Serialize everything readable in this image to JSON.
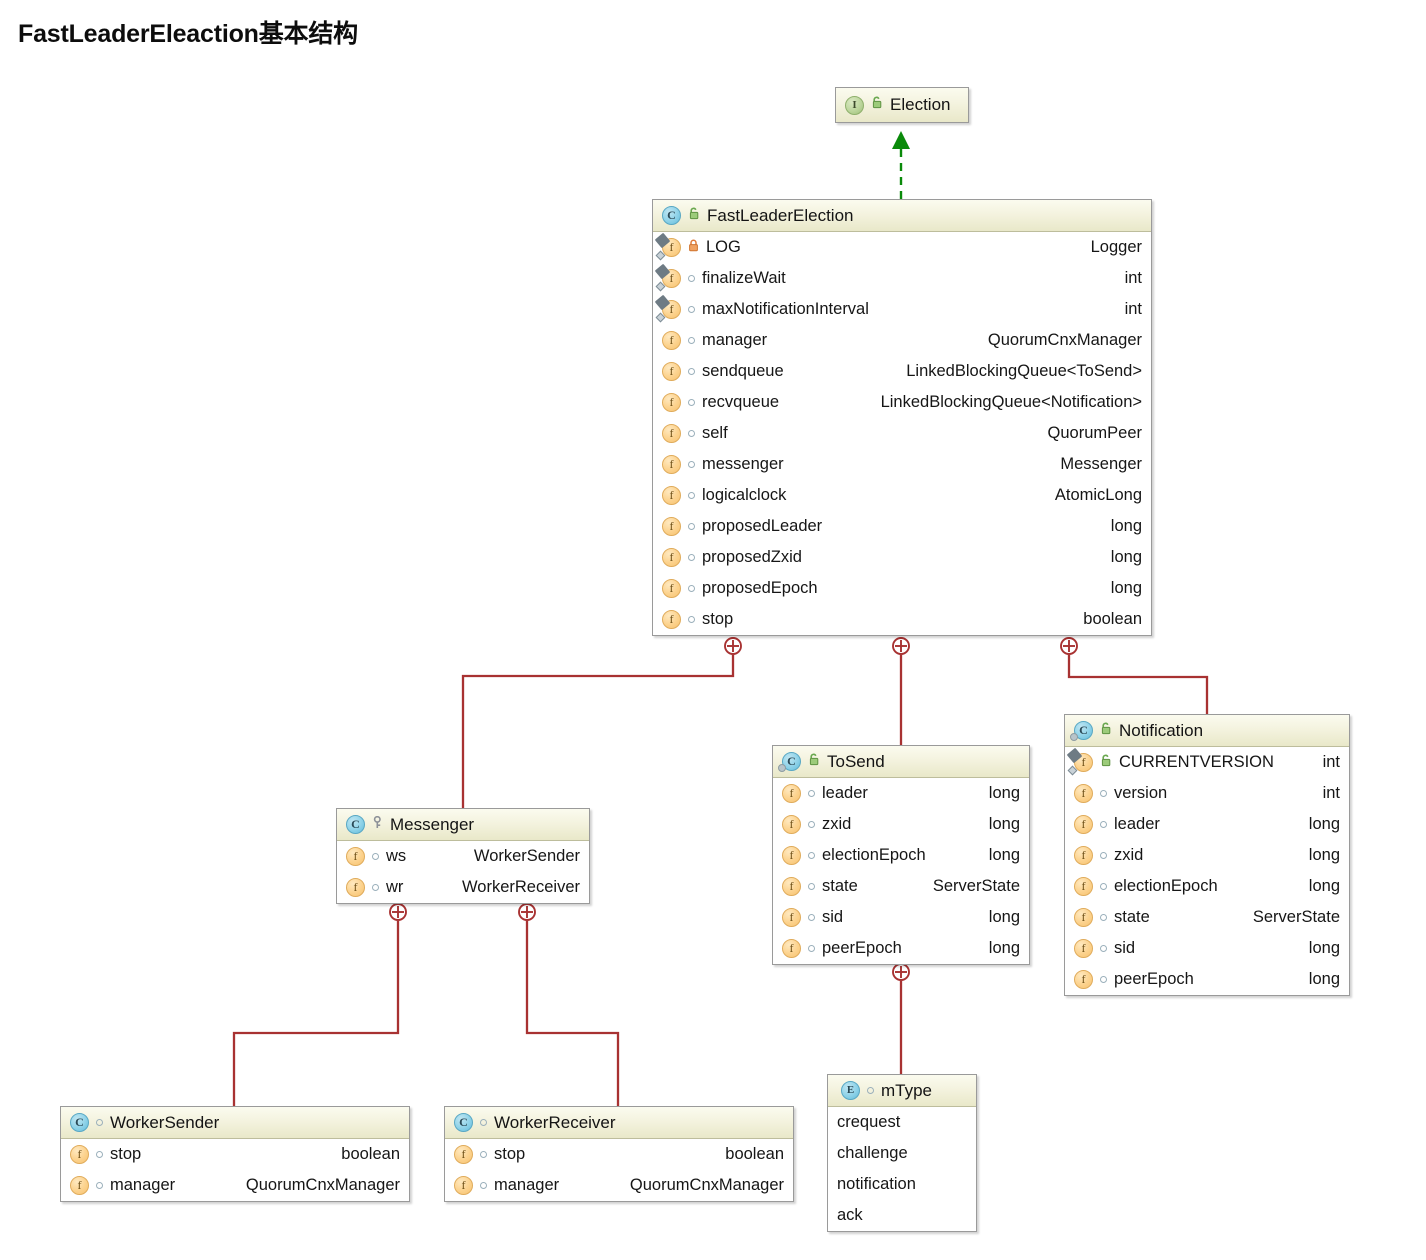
{
  "page": {
    "title": "FastLeaderEleaction基本结构",
    "background": "#ffffff",
    "edge_color": "#a83232",
    "realization_color": "#0a8a0a"
  },
  "nodes": {
    "election": {
      "name": "Election",
      "stereotype": "interface",
      "icon": "interface-icon",
      "visibility_icon": "unlock-icon",
      "members": []
    },
    "fast_leader_election": {
      "name": "FastLeaderElection",
      "stereotype": "class",
      "icon": "class-icon",
      "visibility_icon": "unlock-icon",
      "members": [
        {
          "icon": "static-field-icon",
          "visibility": "private-lock-icon",
          "name": "LOG",
          "type": "Logger"
        },
        {
          "icon": "static-field-icon",
          "visibility": "package-icon",
          "name": "finalizeWait",
          "type": "int"
        },
        {
          "icon": "static-field-icon",
          "visibility": "package-icon",
          "name": "maxNotificationInterval",
          "type": "int"
        },
        {
          "icon": "field-icon",
          "visibility": "package-icon",
          "name": "manager",
          "type": "QuorumCnxManager"
        },
        {
          "icon": "field-icon",
          "visibility": "package-icon",
          "name": "sendqueue",
          "type": "LinkedBlockingQueue<ToSend>"
        },
        {
          "icon": "field-icon",
          "visibility": "package-icon",
          "name": "recvqueue",
          "type": "LinkedBlockingQueue<Notification>"
        },
        {
          "icon": "field-icon",
          "visibility": "package-icon",
          "name": "self",
          "type": "QuorumPeer"
        },
        {
          "icon": "field-icon",
          "visibility": "package-icon",
          "name": "messenger",
          "type": "Messenger"
        },
        {
          "icon": "field-icon",
          "visibility": "package-icon",
          "name": "logicalclock",
          "type": "AtomicLong"
        },
        {
          "icon": "field-icon",
          "visibility": "package-icon",
          "name": "proposedLeader",
          "type": "long"
        },
        {
          "icon": "field-icon",
          "visibility": "package-icon",
          "name": "proposedZxid",
          "type": "long"
        },
        {
          "icon": "field-icon",
          "visibility": "package-icon",
          "name": "proposedEpoch",
          "type": "long"
        },
        {
          "icon": "field-icon",
          "visibility": "package-icon",
          "name": "stop",
          "type": "boolean"
        }
      ]
    },
    "messenger": {
      "name": "Messenger",
      "stereotype": "class",
      "icon": "class-icon",
      "visibility_icon": "key-icon",
      "members": [
        {
          "icon": "field-icon",
          "visibility": "package-icon",
          "name": "ws",
          "type": "WorkerSender"
        },
        {
          "icon": "field-icon",
          "visibility": "package-icon",
          "name": "wr",
          "type": "WorkerReceiver"
        }
      ]
    },
    "to_send": {
      "name": "ToSend",
      "stereotype": "class",
      "icon": "inner-class-icon",
      "visibility_icon": "unlock-icon",
      "members": [
        {
          "icon": "field-icon",
          "visibility": "package-icon",
          "name": "leader",
          "type": "long"
        },
        {
          "icon": "field-icon",
          "visibility": "package-icon",
          "name": "zxid",
          "type": "long"
        },
        {
          "icon": "field-icon",
          "visibility": "package-icon",
          "name": "electionEpoch",
          "type": "long"
        },
        {
          "icon": "field-icon",
          "visibility": "package-icon",
          "name": "state",
          "type": "ServerState"
        },
        {
          "icon": "field-icon",
          "visibility": "package-icon",
          "name": "sid",
          "type": "long"
        },
        {
          "icon": "field-icon",
          "visibility": "package-icon",
          "name": "peerEpoch",
          "type": "long"
        }
      ]
    },
    "notification": {
      "name": "Notification",
      "stereotype": "class",
      "icon": "inner-class-icon",
      "visibility_icon": "unlock-icon",
      "members": [
        {
          "icon": "static-field-icon",
          "visibility": "unlock-icon",
          "name": "CURRENTVERSION",
          "type": "int"
        },
        {
          "icon": "field-icon",
          "visibility": "package-icon",
          "name": "version",
          "type": "int"
        },
        {
          "icon": "field-icon",
          "visibility": "package-icon",
          "name": "leader",
          "type": "long"
        },
        {
          "icon": "field-icon",
          "visibility": "package-icon",
          "name": "zxid",
          "type": "long"
        },
        {
          "icon": "field-icon",
          "visibility": "package-icon",
          "name": "electionEpoch",
          "type": "long"
        },
        {
          "icon": "field-icon",
          "visibility": "package-icon",
          "name": "state",
          "type": "ServerState"
        },
        {
          "icon": "field-icon",
          "visibility": "package-icon",
          "name": "sid",
          "type": "long"
        },
        {
          "icon": "field-icon",
          "visibility": "package-icon",
          "name": "peerEpoch",
          "type": "long"
        }
      ]
    },
    "worker_sender": {
      "name": "WorkerSender",
      "stereotype": "class",
      "icon": "class-icon",
      "visibility_icon": "package-icon",
      "members": [
        {
          "icon": "field-icon",
          "visibility": "package-icon",
          "name": "stop",
          "type": "boolean"
        },
        {
          "icon": "field-icon",
          "visibility": "package-icon",
          "name": "manager",
          "type": "QuorumCnxManager"
        }
      ]
    },
    "worker_receiver": {
      "name": "WorkerReceiver",
      "stereotype": "class",
      "icon": "class-icon",
      "visibility_icon": "package-icon",
      "members": [
        {
          "icon": "field-icon",
          "visibility": "package-icon",
          "name": "stop",
          "type": "boolean"
        },
        {
          "icon": "field-icon",
          "visibility": "package-icon",
          "name": "manager",
          "type": "QuorumCnxManager"
        }
      ]
    },
    "m_type": {
      "name": "mType",
      "stereotype": "enum",
      "icon": "enum-icon",
      "visibility_icon": "package-icon",
      "members": [
        {
          "icon": "none",
          "visibility": "none",
          "name": "crequest",
          "type": ""
        },
        {
          "icon": "none",
          "visibility": "none",
          "name": "challenge",
          "type": ""
        },
        {
          "icon": "none",
          "visibility": "none",
          "name": "notification",
          "type": ""
        },
        {
          "icon": "none",
          "visibility": "none",
          "name": "ack",
          "type": ""
        }
      ]
    }
  },
  "edges": [
    {
      "from": "fast_leader_election",
      "to": "election",
      "kind": "realization",
      "marker": "arrow-triangle-open"
    },
    {
      "from": "fast_leader_election",
      "to": "messenger",
      "kind": "inner-class",
      "marker": "circle-plus-icon"
    },
    {
      "from": "fast_leader_election",
      "to": "to_send",
      "kind": "inner-class",
      "marker": "circle-plus-icon"
    },
    {
      "from": "fast_leader_election",
      "to": "notification",
      "kind": "inner-class",
      "marker": "circle-plus-icon"
    },
    {
      "from": "messenger",
      "to": "worker_sender",
      "kind": "inner-class",
      "marker": "circle-plus-icon"
    },
    {
      "from": "messenger",
      "to": "worker_receiver",
      "kind": "inner-class",
      "marker": "circle-plus-icon"
    },
    {
      "from": "to_send",
      "to": "m_type",
      "kind": "inner-class",
      "marker": "circle-plus-icon"
    }
  ]
}
